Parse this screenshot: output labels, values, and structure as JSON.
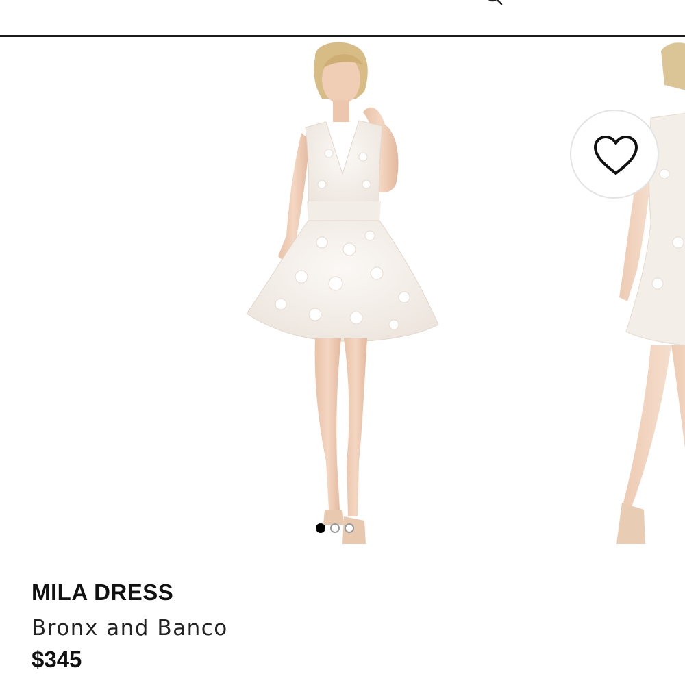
{
  "header": {
    "search_icon": "search-icon"
  },
  "carousel": {
    "images": [
      {
        "alt_icon": "dress-front-photo"
      },
      {
        "alt_icon": "dress-side-photo"
      },
      {
        "alt_icon": "dress-back-photo"
      }
    ],
    "active_index": 0,
    "dot_count": 3
  },
  "wishlist": {
    "icon": "heart-outline-icon"
  },
  "product": {
    "name": "MILA DRESS",
    "brand": "Bronx and Banco",
    "price": "$345"
  },
  "colors": {
    "background": "#ffffff",
    "text": "#111111",
    "divider": "#1a1a1a",
    "dress": "#f6f1ec",
    "skin": "#efcdb6"
  }
}
